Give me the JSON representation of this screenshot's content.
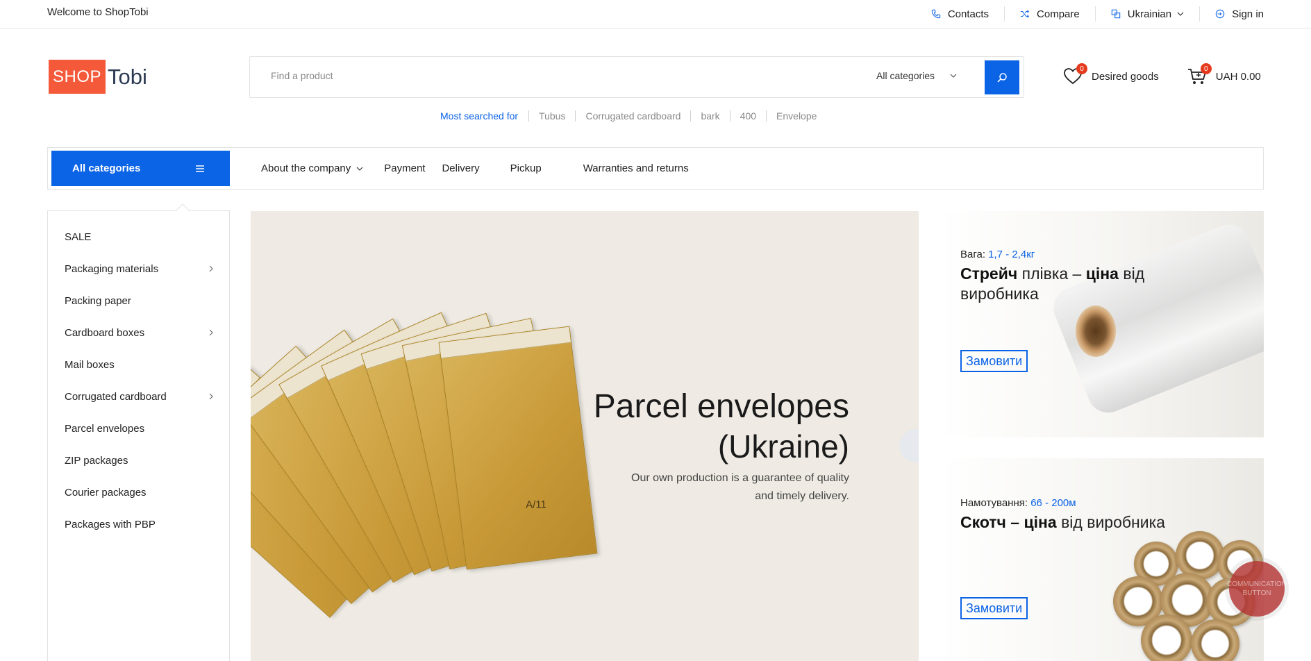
{
  "topbar": {
    "welcome": "Welcome to ShopTobi",
    "contacts": "Contacts",
    "compare": "Compare",
    "language": "Ukrainian",
    "sign_in": "Sign in"
  },
  "logo": {
    "shop": "SHOP",
    "tobi": "Tobi"
  },
  "search": {
    "placeholder": "Find a product",
    "category": "All categories"
  },
  "header": {
    "wishlist_count": "0",
    "wishlist_label": "Desired goods",
    "cart_count": "0",
    "cart_total": "UAH 0.00"
  },
  "popular": {
    "label": "Most searched for",
    "items": [
      "Tubus",
      "Corrugated cardboard",
      "bark",
      "400",
      "Envelope"
    ]
  },
  "nav": {
    "all_categories": "All categories",
    "links": [
      "About the company",
      "Payment",
      "Delivery",
      "Pickup",
      "Warranties and returns"
    ]
  },
  "sidebar": {
    "items": [
      {
        "label": "SALE"
      },
      {
        "label": "Packaging materials"
      },
      {
        "label": "Packing paper"
      },
      {
        "label": "Cardboard boxes"
      },
      {
        "label": "Mail boxes"
      },
      {
        "label": "Corrugated cardboard"
      },
      {
        "label": "Parcel envelopes"
      },
      {
        "label": "ZIP packages"
      },
      {
        "label": "Courier packages"
      },
      {
        "label": "Packages with PBP"
      }
    ]
  },
  "hero": {
    "title": "Parcel envelopes",
    "subtitle": "(Ukraine)",
    "text": "Our own production is a guarantee of quality and timely delivery.",
    "envelope_label": "A/11"
  },
  "promo1": {
    "spec_label": "Вага:",
    "spec_value": "1,7 - 2,4кг",
    "title_bold1": "Стрейч",
    "title_part1": " плівка – ",
    "title_bold2": "ціна",
    "title_part2": " від виробника",
    "button": "Замовити"
  },
  "promo2": {
    "spec_label": "Намотування:",
    "spec_value": "66 - 200м",
    "title_bold1": "Скотч – ціна",
    "title_part1": " від виробника",
    "button": "Замовити"
  },
  "comm_button": "COMMUNICATION BUTTON",
  "colors": {
    "accent": "#0b63e5",
    "logo_orange": "#f4593a",
    "badge": "#e53a1e",
    "hero_bg": "#efebe4"
  }
}
